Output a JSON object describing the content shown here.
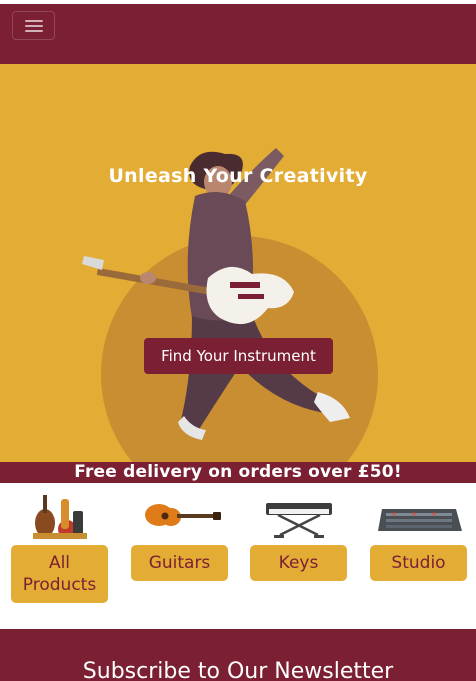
{
  "header": {
    "menu_icon": "hamburger-menu-icon"
  },
  "hero": {
    "title": "Unleash Your Creativity",
    "cta_label": "Find Your Instrument"
  },
  "promo": {
    "text": "Free delivery on orders over £50!"
  },
  "categories": [
    {
      "label": "All Products",
      "icon": "instruments-group-icon"
    },
    {
      "label": "Guitars",
      "icon": "acoustic-guitar-icon"
    },
    {
      "label": "Keys",
      "icon": "keyboard-icon"
    },
    {
      "label": "Studio",
      "icon": "mixing-console-icon"
    }
  ],
  "newsletter": {
    "title": "Subscribe to Our Newsletter"
  },
  "colors": {
    "brand": "#7b1f33",
    "accent": "#e3ac35",
    "accent_dark": "#c98d32"
  }
}
